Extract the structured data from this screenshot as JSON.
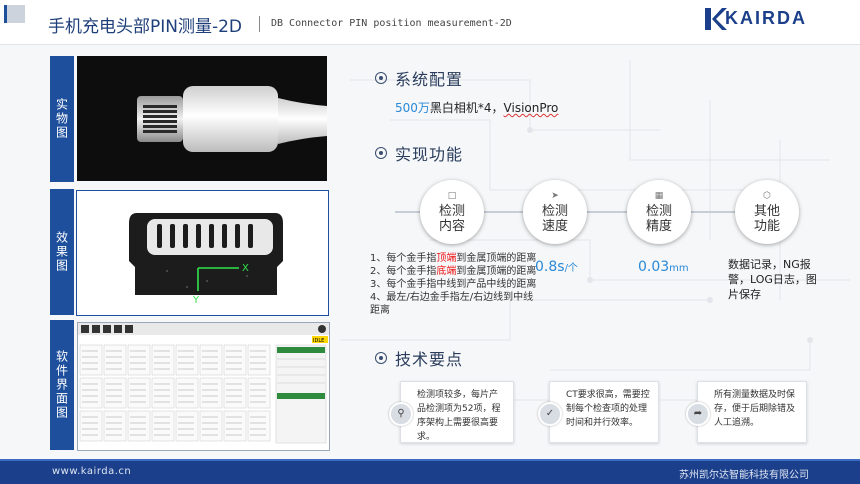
{
  "header": {
    "title": "手机充电头部PIN测量-2D",
    "subtitle": "DB Connector PIN position measurement-2D",
    "logo": "KAIRDA"
  },
  "side_labels": [
    "实物图",
    "效果图",
    "软件界面图"
  ],
  "sections": {
    "config": {
      "title": "系统配置",
      "num": "500万",
      "text": "黑白相机*4，",
      "software": "VisionPro"
    },
    "functions": {
      "title": "实现功能"
    },
    "tech": {
      "title": "技术要点"
    }
  },
  "circles": [
    {
      "icon": "document-icon",
      "label": "检测内容"
    },
    {
      "icon": "plane-icon",
      "label": "检测速度"
    },
    {
      "icon": "ruler-icon",
      "label": "检测精度"
    },
    {
      "icon": "cube-icon",
      "label": "其他功能"
    }
  ],
  "detection_items": [
    {
      "pre": "1、每个金手指",
      "hl": "顶端",
      "post": "到金属顶端的距离"
    },
    {
      "pre": "2、每个金手指",
      "hl": "底端",
      "post": "到金属顶端的距离"
    },
    {
      "pre": "3、每个金手指中线到产品中线的距离",
      "hl": "",
      "post": ""
    },
    {
      "pre": "4、最左/右边金手指左/右边线到中线距离",
      "hl": "",
      "post": ""
    }
  ],
  "speed": {
    "value": "0.8s",
    "unit": "/个"
  },
  "precision": {
    "value": "0.03",
    "unit": "mm"
  },
  "other_functions": "数据记录，NG报警，LOG日志，图片保存",
  "tech_cards": [
    {
      "icon": "search-icon",
      "text": "检测项较多，每片产品检测项为52项，程序架构上需要很高要求。"
    },
    {
      "icon": "check-icon",
      "text": "CT要求很高，需要控制每个检查项的处理时间和并行效率。"
    },
    {
      "icon": "share-icon",
      "text": "所有测量数据及时保存，便于后期除错及人工追溯。"
    }
  ],
  "software": {
    "status": "IDLE"
  },
  "footer": {
    "site": "www.kairda.cn",
    "company": "苏州凯尔达智能科技有限公司"
  },
  "colors": {
    "brand": "#1b3f8a",
    "accent": "#2a89d6",
    "highlight": "#e11111"
  }
}
